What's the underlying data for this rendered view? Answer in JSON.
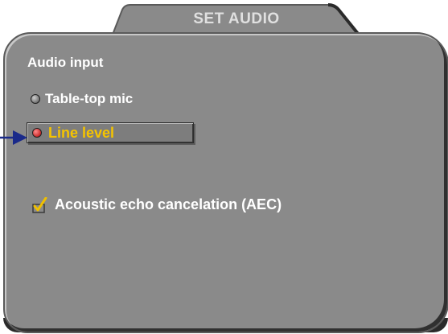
{
  "window": {
    "title": "SET AUDIO"
  },
  "audio_input": {
    "label": "Audio input",
    "options": [
      {
        "label": "Table-top mic",
        "selected": false
      },
      {
        "label": "Line level",
        "selected": true
      }
    ]
  },
  "aec": {
    "label": "Acoustic echo cancelation (AEC)",
    "checked": true
  },
  "colors": {
    "panel": "#8a8a8a",
    "selected_text": "#f5c400",
    "radio_on": "#cc0000",
    "pointer_arrow": "#1a2a8a",
    "check_mark": "#f0c000"
  },
  "icons": [
    "radio-off-icon",
    "radio-on-icon",
    "checkmark-icon",
    "pointer-arrow-icon"
  ]
}
